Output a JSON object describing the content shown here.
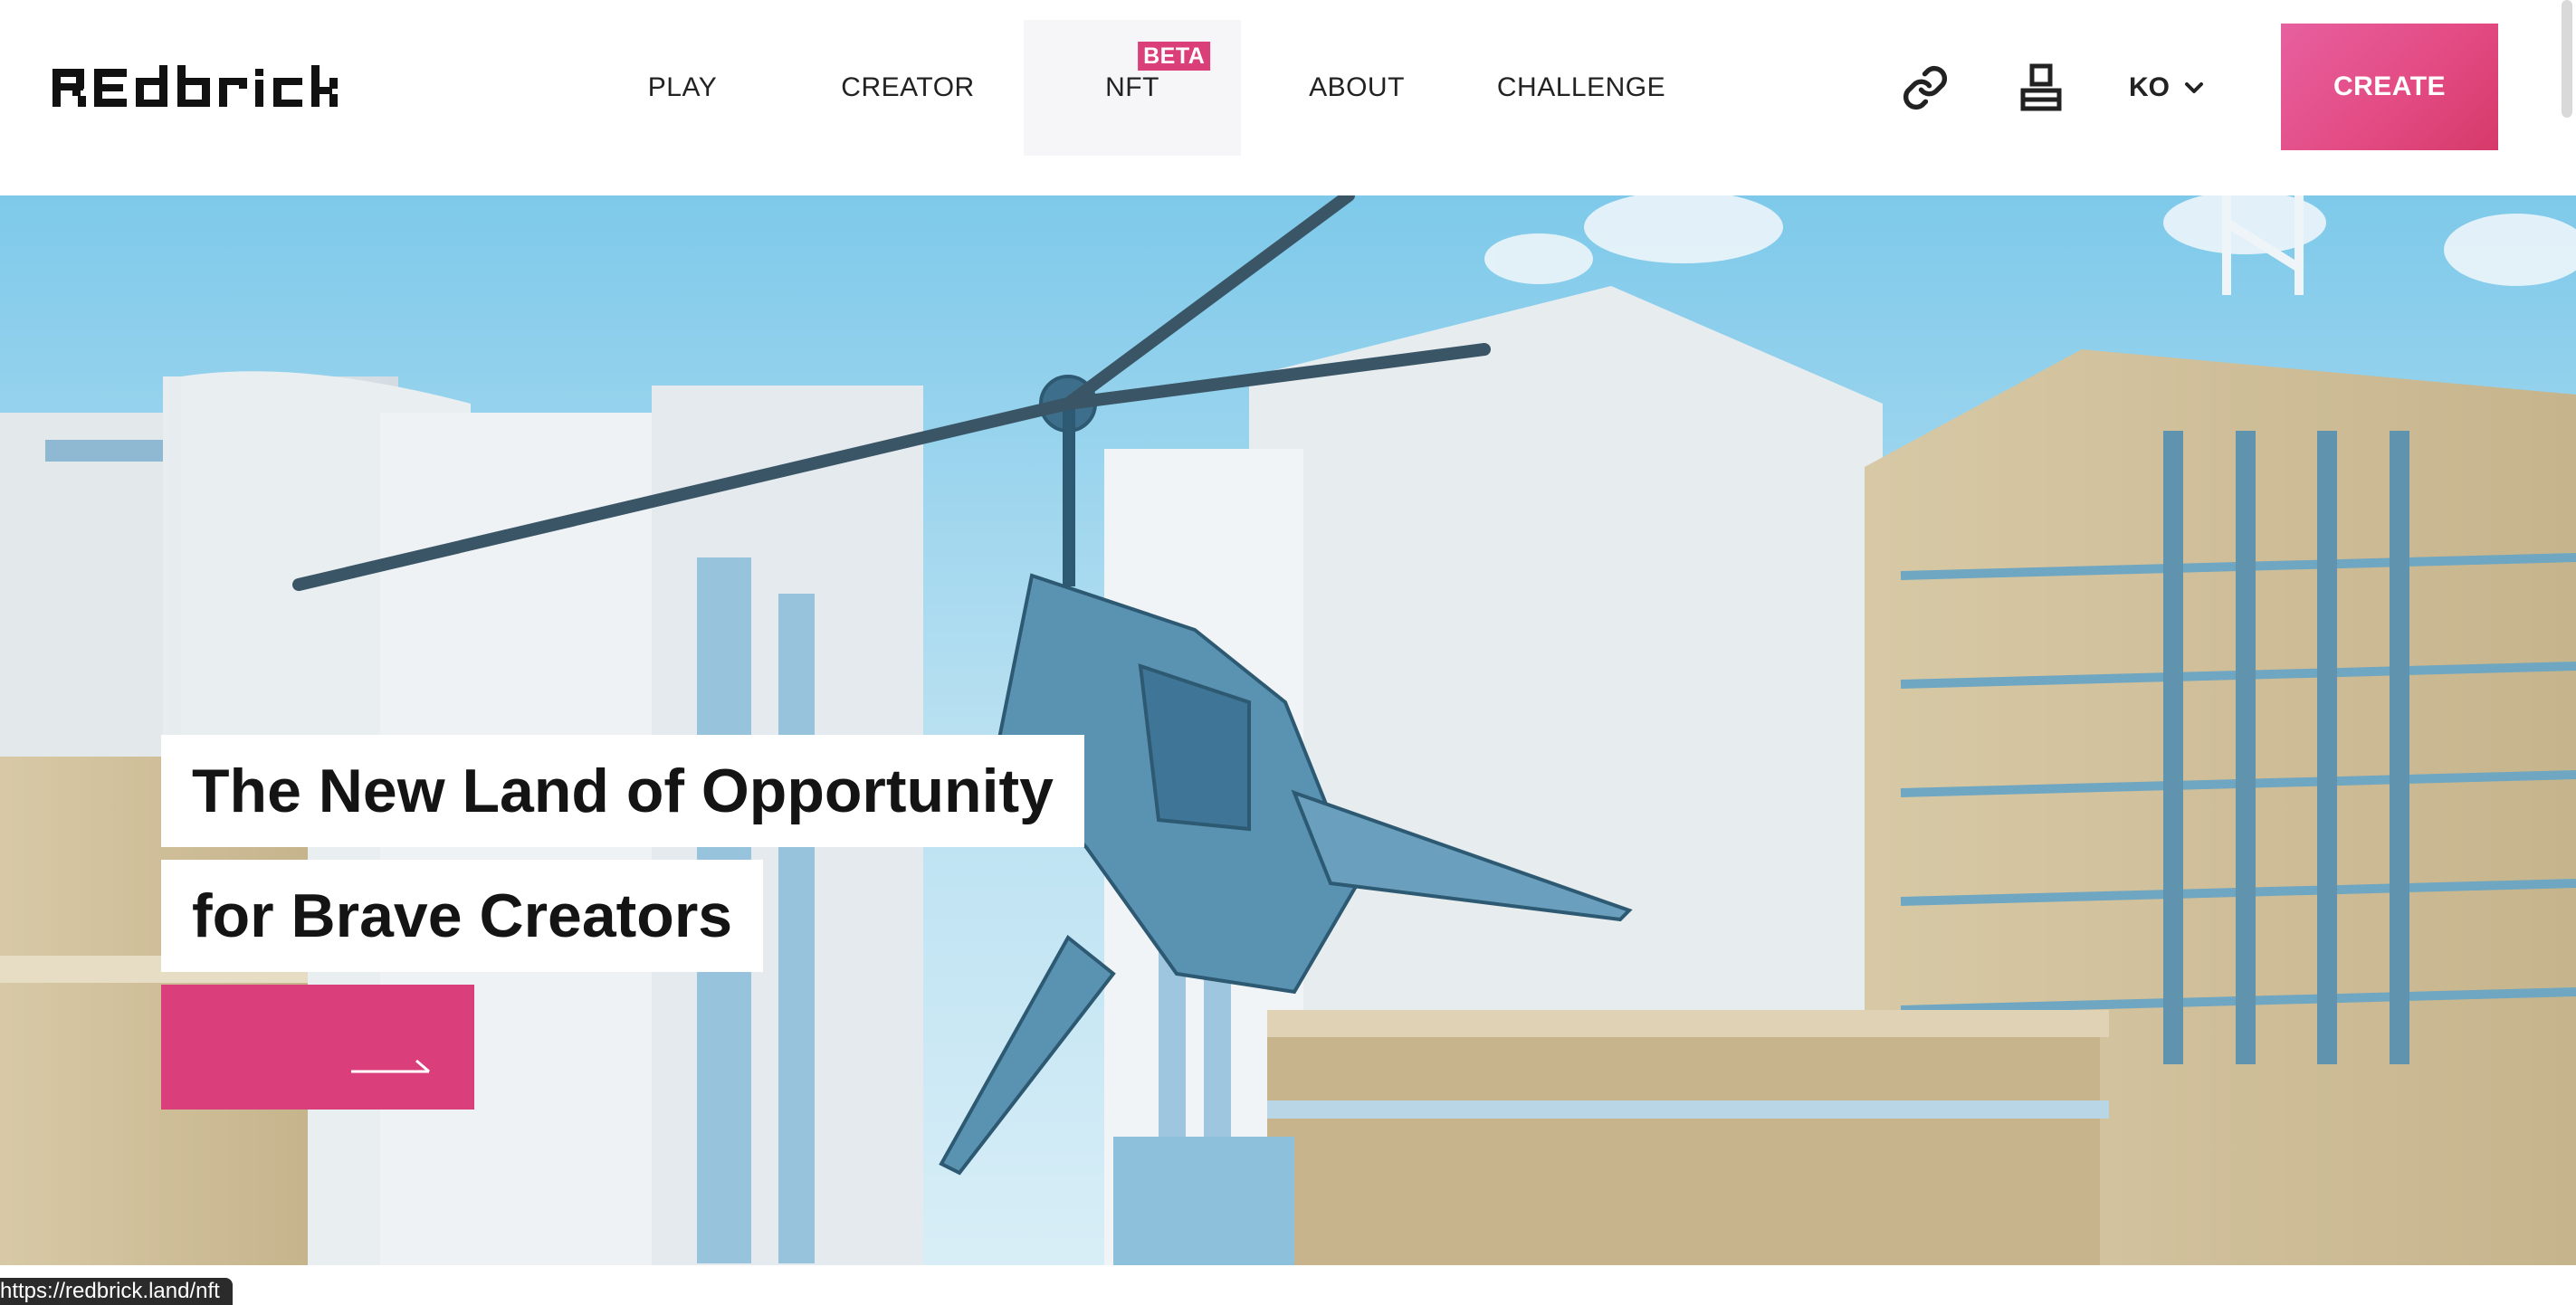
{
  "header": {
    "logo_text": "Redbrick",
    "nav": [
      {
        "label": "PLAY",
        "active": false
      },
      {
        "label": "CREATOR",
        "active": false
      },
      {
        "label": "NFT",
        "badge": "Beta",
        "active": true
      },
      {
        "label": "ABOUT",
        "active": false
      },
      {
        "label": "CHALLENGE",
        "active": false
      }
    ],
    "icons": [
      "link-icon",
      "user-icon",
      "chevron-down-icon"
    ],
    "language": "KO",
    "create_label": "CREATE"
  },
  "hero": {
    "headline_line1": "The New Land of Opportunity",
    "headline_line2": "for Brave Creators",
    "cta_icon": "arrow-right-icon"
  },
  "status_bar": {
    "url": "https://redbrick.land/nft"
  },
  "colors": {
    "accent": "#db3f7b",
    "badge": "#da3f7a",
    "text": "#222222"
  }
}
